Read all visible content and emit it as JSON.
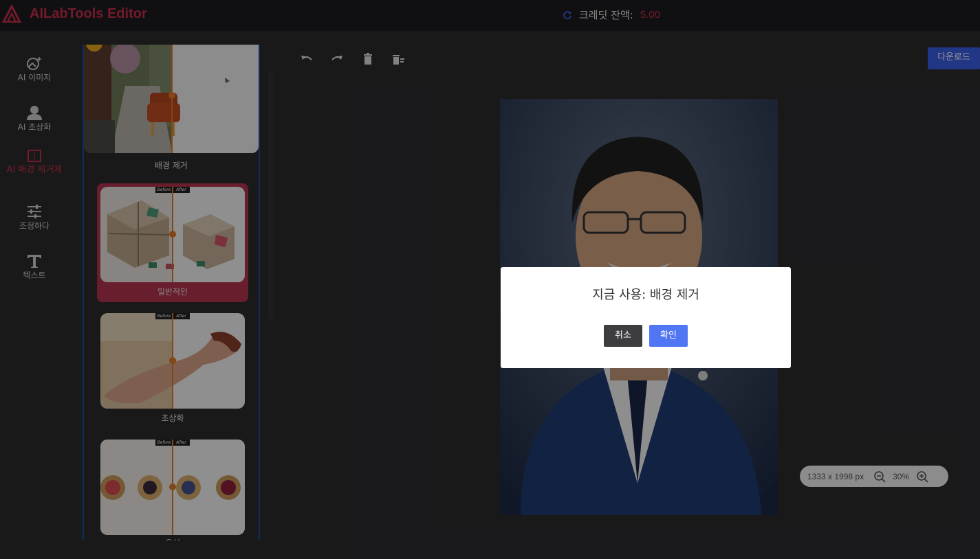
{
  "app": {
    "name": "AILabTools Editor",
    "brand_color": "#c42f4a"
  },
  "header": {
    "credits_label": "크레딧 잔액:",
    "credits_value": "5.00",
    "refresh_icon": "refresh-icon"
  },
  "sidebar": {
    "items": [
      {
        "label": "AI 이미지",
        "icon": "ai-image-icon",
        "active": false
      },
      {
        "label": "AI 초상화",
        "icon": "portrait-icon",
        "active": false
      },
      {
        "label": "AI 배경 제거제",
        "icon": "background-remove-icon",
        "active": true
      },
      {
        "label": "조정하다",
        "icon": "sliders-icon",
        "active": false
      },
      {
        "label": "텍스트",
        "icon": "text-icon",
        "active": false
      }
    ]
  },
  "templates": {
    "items": [
      {
        "caption": "배경 제거",
        "selected": false
      },
      {
        "caption": "일반적인",
        "selected": true,
        "before": "Before",
        "after": "After"
      },
      {
        "caption": "초상화",
        "selected": false,
        "before": "Before",
        "after": "After"
      },
      {
        "caption": "음식",
        "selected": false,
        "before": "Before",
        "after": "After"
      }
    ]
  },
  "toolbar": {
    "undo_icon": "undo-icon",
    "redo_icon": "redo-icon",
    "delete_icon": "trash-icon",
    "clear_icon": "clear-all-icon",
    "download_label": "다운로드"
  },
  "zoom": {
    "dimensions": "1333 x 1998 px",
    "percent": "30%"
  },
  "dialog": {
    "title": "지금 사용: 배경 제거",
    "cancel_label": "취소",
    "confirm_label": "확인"
  }
}
